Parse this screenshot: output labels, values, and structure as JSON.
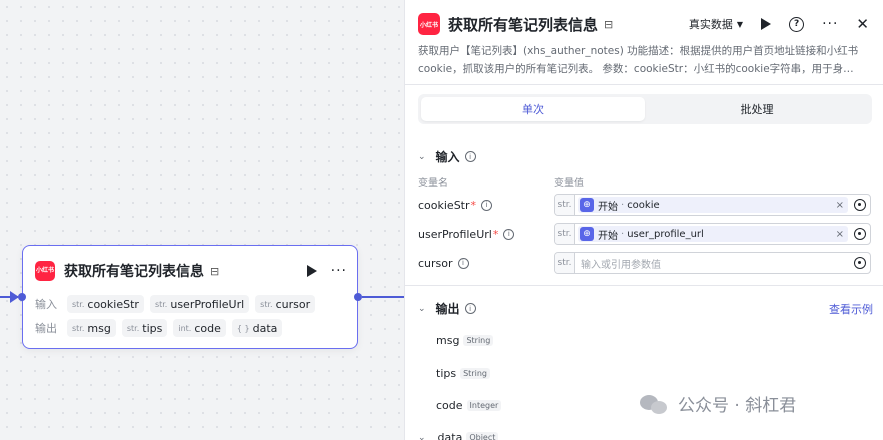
{
  "node": {
    "logo_text": "小红书",
    "title": "获取所有笔记列表信息",
    "input_label": "输入",
    "output_label": "输出",
    "inputs": [
      {
        "type": "str.",
        "name": "cookieStr"
      },
      {
        "type": "str.",
        "name": "userProfileUrl"
      },
      {
        "type": "str.",
        "name": "cursor"
      }
    ],
    "outputs": [
      {
        "type": "str.",
        "name": "msg"
      },
      {
        "type": "str.",
        "name": "tips"
      },
      {
        "type": "int.",
        "name": "code"
      },
      {
        "type": "{ }",
        "name": "data"
      }
    ]
  },
  "panel": {
    "logo_text": "小红书",
    "title": "获取所有笔记列表信息",
    "mode_label": "真实数据",
    "description": "获取用户【笔记列表】(xhs_auther_notes) 功能描述：根据提供的用户首页地址链接和小红书cookie，抓取该用户的所有笔记列表。 参数：cookieStr：小红书的cookie字符串，用于身…",
    "tabs": [
      {
        "label": "单次",
        "active": true
      },
      {
        "label": "批处理",
        "active": false
      }
    ],
    "input_section": {
      "title": "输入",
      "col_name": "变量名",
      "col_value": "变量值",
      "params": [
        {
          "name": "cookieStr",
          "required": "*",
          "type": "str.",
          "ref_source": "开始",
          "ref_sep": "·",
          "ref_var": "cookie"
        },
        {
          "name": "userProfileUrl",
          "required": "*",
          "type": "str.",
          "ref_source": "开始",
          "ref_sep": "·",
          "ref_var": "user_profile_url"
        },
        {
          "name": "cursor",
          "required": "",
          "type": "str.",
          "placeholder": "输入或引用参数值"
        }
      ]
    },
    "output_section": {
      "title": "输出",
      "example_link": "查看示例",
      "fields": [
        {
          "name": "msg",
          "type": "String"
        },
        {
          "name": "tips",
          "type": "String"
        },
        {
          "name": "code",
          "type": "Integer"
        },
        {
          "name": "data",
          "type": "Object"
        }
      ]
    }
  },
  "watermark": {
    "text": "公众号 · 斜杠君"
  }
}
